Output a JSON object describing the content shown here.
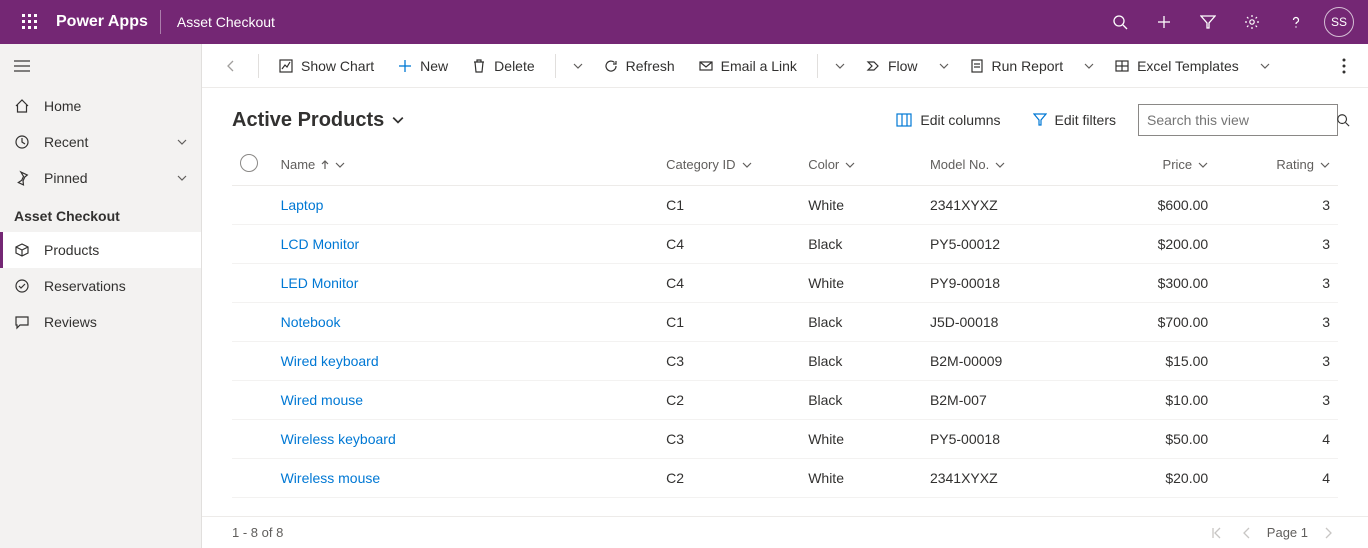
{
  "header": {
    "product": "Power Apps",
    "app_title": "Asset Checkout",
    "avatar_initials": "SS"
  },
  "sidebar": {
    "home": "Home",
    "recent": "Recent",
    "pinned": "Pinned",
    "group_label": "Asset Checkout",
    "products": "Products",
    "reservations": "Reservations",
    "reviews": "Reviews"
  },
  "cmdbar": {
    "show_chart": "Show Chart",
    "new": "New",
    "delete": "Delete",
    "refresh": "Refresh",
    "email_link": "Email a Link",
    "flow": "Flow",
    "run_report": "Run Report",
    "excel_templates": "Excel Templates"
  },
  "view": {
    "title": "Active Products",
    "edit_columns": "Edit columns",
    "edit_filters": "Edit filters",
    "search_placeholder": "Search this view"
  },
  "columns": {
    "name": "Name",
    "category": "Category ID",
    "color": "Color",
    "model": "Model No.",
    "price": "Price",
    "rating": "Rating"
  },
  "rows": [
    {
      "name": "Laptop",
      "category": "C1",
      "color": "White",
      "model": "2341XYXZ",
      "price": "$600.00",
      "rating": "3"
    },
    {
      "name": "LCD Monitor",
      "category": "C4",
      "color": "Black",
      "model": "PY5-00012",
      "price": "$200.00",
      "rating": "3"
    },
    {
      "name": "LED Monitor",
      "category": "C4",
      "color": "White",
      "model": "PY9-00018",
      "price": "$300.00",
      "rating": "3"
    },
    {
      "name": "Notebook",
      "category": "C1",
      "color": "Black",
      "model": "J5D-00018",
      "price": "$700.00",
      "rating": "3"
    },
    {
      "name": "Wired keyboard",
      "category": "C3",
      "color": "Black",
      "model": "B2M-00009",
      "price": "$15.00",
      "rating": "3"
    },
    {
      "name": "Wired mouse",
      "category": "C2",
      "color": "Black",
      "model": "B2M-007",
      "price": "$10.00",
      "rating": "3"
    },
    {
      "name": "Wireless keyboard",
      "category": "C3",
      "color": "White",
      "model": "PY5-00018",
      "price": "$50.00",
      "rating": "4"
    },
    {
      "name": "Wireless mouse",
      "category": "C2",
      "color": "White",
      "model": "2341XYXZ",
      "price": "$20.00",
      "rating": "4"
    }
  ],
  "footer": {
    "range": "1 - 8 of 8",
    "page_label": "Page 1"
  }
}
